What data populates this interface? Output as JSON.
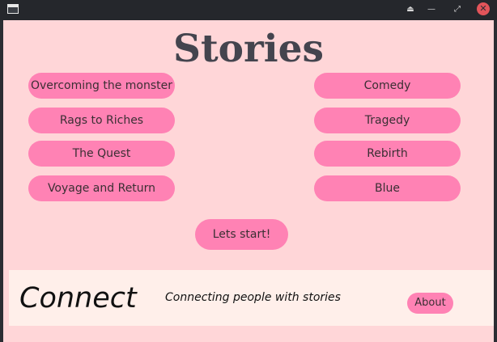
{
  "window": {
    "titlebar_buttons": [
      "eject-icon",
      "minimize-icon",
      "maximize-icon",
      "close-icon"
    ]
  },
  "page": {
    "title": "Stories"
  },
  "stories": {
    "left": [
      "Overcoming the monster",
      "Rags to Riches",
      "The Quest",
      "Voyage and Return"
    ],
    "right": [
      "Comedy",
      "Tragedy",
      "Rebirth",
      "Blue"
    ]
  },
  "actions": {
    "start_label": "Lets start!"
  },
  "footer": {
    "brand": "Connect",
    "tagline": "Connecting people with stories",
    "about_label": "About"
  },
  "colors": {
    "background": "#ffd6d8",
    "button": "#ff82b4",
    "footer": "#ffefea",
    "title_text": "#44444e",
    "close_button": "#e2545a"
  }
}
